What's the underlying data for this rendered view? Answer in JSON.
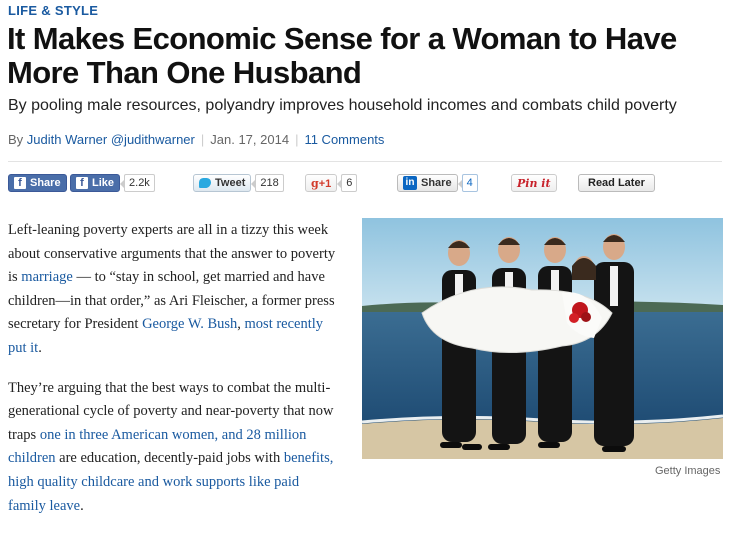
{
  "section": "LIFE & STYLE",
  "headline": "It Makes Economic Sense for a Woman to Have More Than One Husband",
  "dek": "By pooling male resources, polyandry improves household incomes and combats child poverty",
  "byline": {
    "prefix": "By",
    "author": "Judith Warner",
    "handle": "@judithwarner",
    "date": "Jan. 17, 2014",
    "comments": "11 Comments"
  },
  "share": {
    "fb_share": "Share",
    "fb_like": "Like",
    "fb_like_count": "2.2k",
    "tweet": "Tweet",
    "tweet_count": "218",
    "gplus": "+1",
    "gplus_count": "6",
    "linkedin": "Share",
    "linkedin_icon": "in",
    "linkedin_count": "4",
    "pinterest": "Pin it",
    "read_later": "Read Later"
  },
  "article": {
    "p1": {
      "a": "Left-leaning poverty experts are all in a tizzy this week about conservative arguments that the answer to poverty is ",
      "link1": "marriage",
      "b": " — to “stay in school, get married and have children—in that order,” as Ari Fleischer, a former press secretary for President ",
      "link2": "George W. Bush",
      "c": ", ",
      "link3": "most recently put it",
      "d": "."
    },
    "p2": {
      "a": "They’re arguing that the best ways to combat the multi-generational cycle of poverty and near-poverty that now traps ",
      "link1": "one in three American women, and 28 million children",
      "b": " are education, decently-paid jobs with ",
      "link2": "benefits, high quality childcare and work supports like paid family leave",
      "c": "."
    }
  },
  "photo": {
    "credit": "Getty Images"
  },
  "colors": {
    "accent": "#1a5aa0",
    "facebook": "#3b5998",
    "twitter": "#2aa9e0",
    "linkedin": "#0a66c2",
    "pinterest": "#c8232c"
  }
}
